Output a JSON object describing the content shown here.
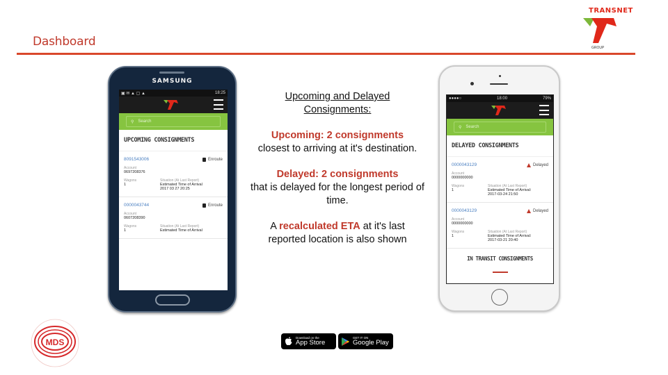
{
  "slide": {
    "title": "Dashboard",
    "brand_name": "TRANSNET",
    "brand_sub": "GROUP",
    "accent_color": "#d9472b"
  },
  "android_phone": {
    "brand": "SAMSUNG",
    "status_time": "18:25",
    "search_placeholder": "Search",
    "section_title": "UPCOMING CONSIGNMENTS",
    "cards": [
      {
        "id": "8091543006",
        "status": "Enroute",
        "account_label": "Account",
        "account": "0697208376",
        "wagons_label": "Wagons",
        "wagons": "1",
        "situation_label": "Situation (At Last Report)",
        "eta_label": "Estimated Time of Arrival",
        "eta": "2017 03 27 20:25"
      },
      {
        "id": "0000043744",
        "status": "Enroute",
        "account_label": "Account",
        "account": "0607208390",
        "wagons_label": "Wagons",
        "wagons": "1",
        "situation_label": "Situation (At Last Report)",
        "eta_label": "Estimated Time of Arrival",
        "eta": ""
      }
    ]
  },
  "ios_phone": {
    "status_time": "18:00",
    "status_battery": "79%",
    "search_placeholder": "Search",
    "section_title": "DELAYED CONSIGNMENTS",
    "cards": [
      {
        "id": "0000043129",
        "status": "Delayed",
        "account_label": "Account",
        "account": "0000000000",
        "wagons_label": "Wagons",
        "wagons": "1",
        "situation_label": "Situation (At Last Report)",
        "eta_label": "Estimated Time of Arrival:",
        "eta": "2017-03-24 21:50"
      },
      {
        "id": "0000043129",
        "status": "Delayed",
        "account_label": "Account",
        "account": "0000000000",
        "wagons_label": "Wagons",
        "wagons": "1",
        "situation_label": "Situation (At Last Report)",
        "eta_label": "Estimated Time of Arrival:",
        "eta": "2017-03-21 20:40"
      }
    ],
    "bottom_section_title": "IN TRANSIT CONSIGNMENTS"
  },
  "description": {
    "heading_line1": "Upcoming and Delayed",
    "heading_line2": "Consignments:",
    "upcoming_em": "Upcoming: 2 consignments",
    "upcoming_text": "closest to arriving at it's destination.",
    "delayed_em": "Delayed: 2 consignments",
    "delayed_text": "that is delayed for the longest period of time.",
    "eta_prefix": "A",
    "eta_em": "recalculated ETA",
    "eta_text": "at it's last reported location is also shown"
  },
  "badges": {
    "app_store_small": "Download on the",
    "app_store_big": "App Store",
    "google_play_small": "GET IT ON",
    "google_play_big": "Google Play"
  },
  "mds_logo": {
    "text": "MDS"
  }
}
